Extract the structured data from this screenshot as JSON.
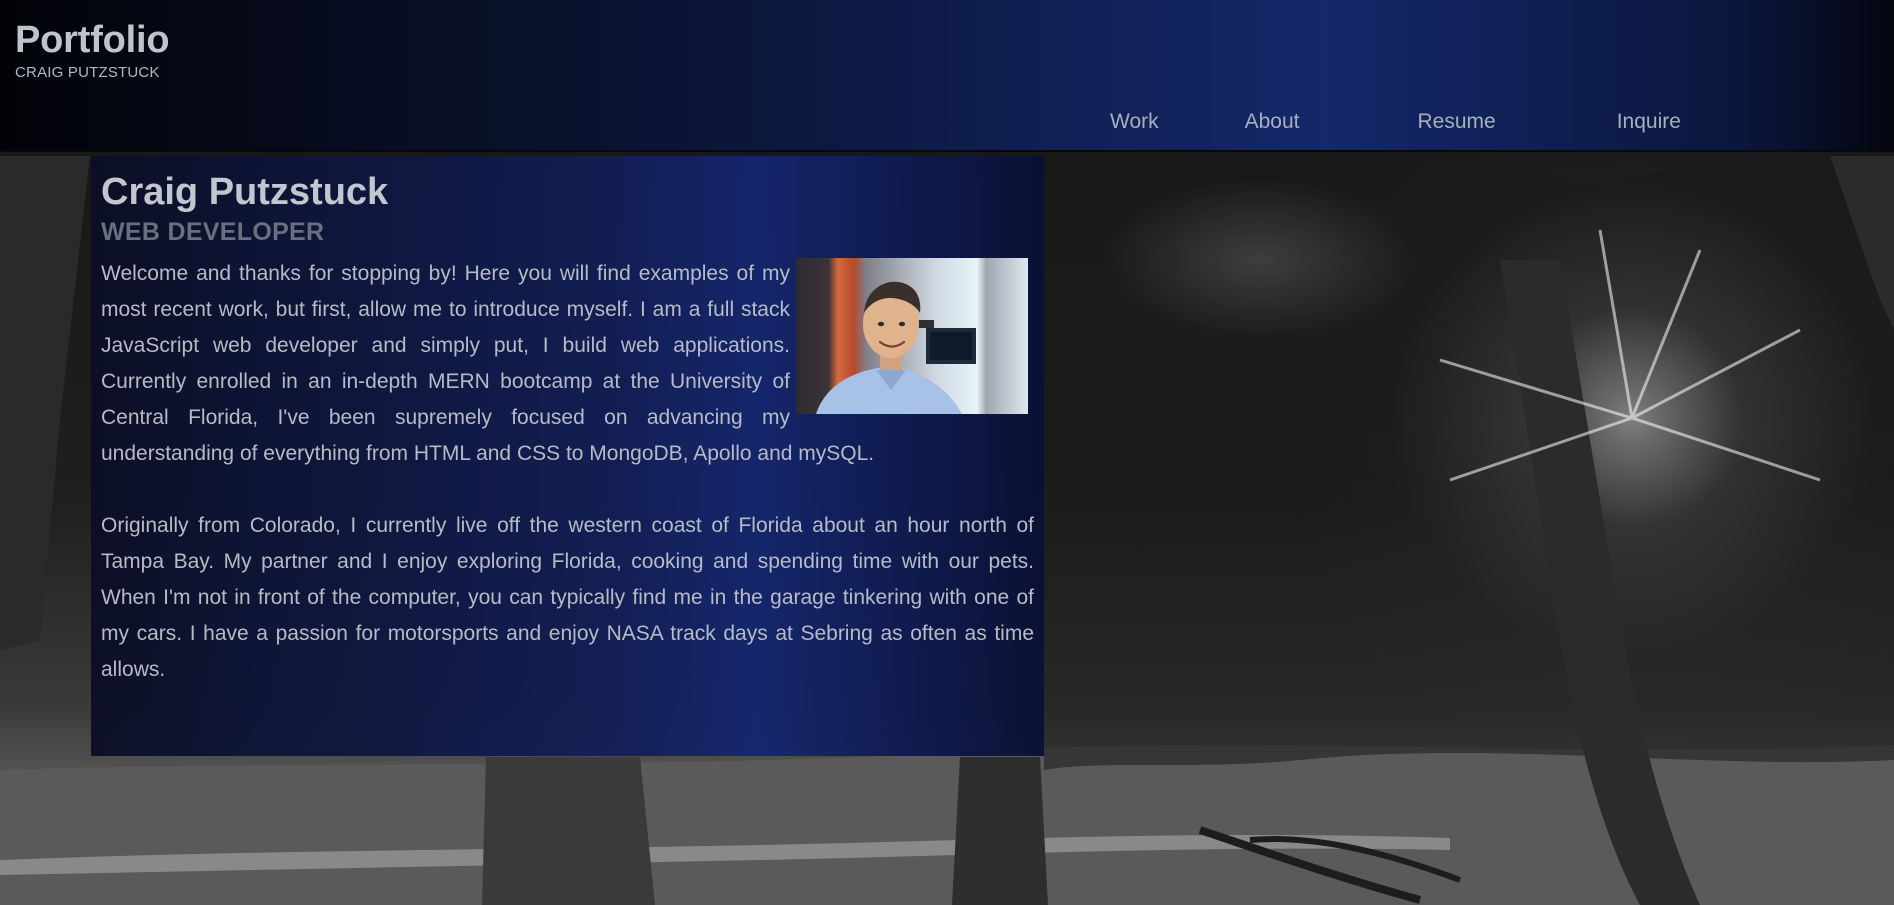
{
  "site": {
    "brand_title": "Portfolio",
    "brand_subtitle": "CRAIG PUTZSTUCK"
  },
  "nav": {
    "items": [
      {
        "label": "Work"
      },
      {
        "label": "About"
      },
      {
        "label": "Resume"
      },
      {
        "label": "Inquire"
      }
    ]
  },
  "about": {
    "name": "Craig Putzstuck",
    "role": "WEB DEVELOPER",
    "paragraphs": [
      "Welcome and thanks for stopping by! Here you will find examples of my most recent work, but first, allow me to introduce myself. I am a full stack JavaScript web developer and simply put, I build web applications. Currently enrolled in an in-depth MERN bootcamp at the University of Central Florida, I've been supremely focused on advancing my understanding of everything from HTML and CSS to MongoDB, Apollo and mySQL.",
      "Originally from Colorado, I currently live off the western coast of Florida about an hour north of Tampa Bay. My partner and I enjoy exploring Florida, cooking and spending time with our pets. When I'm not in front of the computer, you can typically find me in the garage tinkering with one of my cars. I have a passion for motorsports and enjoy NASA track days at Sebring as often as time allows."
    ]
  },
  "colors": {
    "header_gradient_mid": "#14286a",
    "panel_gradient_mid": "#14266e",
    "text": "#b6bbc6",
    "role_text": "#6a6f7d"
  }
}
